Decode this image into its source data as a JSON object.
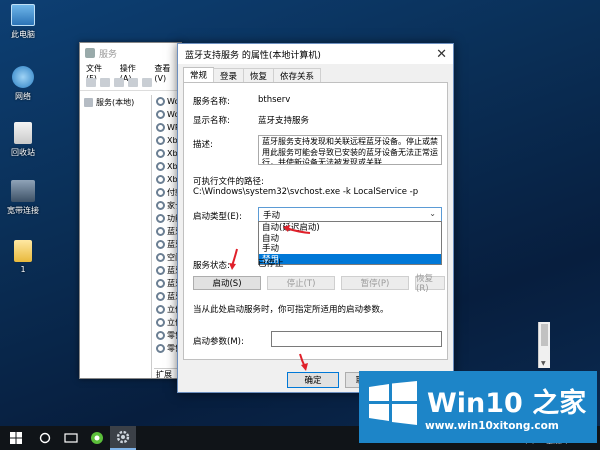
{
  "desktop": {
    "icons": [
      {
        "name": "pc-icon",
        "label": "此电脑"
      },
      {
        "name": "network-icon",
        "label": "网络"
      },
      {
        "name": "recycle-bin-icon",
        "label": "回收站"
      },
      {
        "name": "broadband-icon",
        "label": "宽带连接"
      },
      {
        "name": "folder-icon",
        "label": "1"
      }
    ]
  },
  "services_window": {
    "title": "服务",
    "menu": [
      "文件(F)",
      "操作(A)",
      "查看(V)"
    ],
    "tree_root": "服务(本地)",
    "services": [
      "Wo",
      "Wo",
      "WP",
      "Xb",
      "Xb",
      "Xb",
      "Xb",
      "付款",
      "家长",
      "功能",
      "蓝牙",
      "蓝牙",
      "空间",
      "蓝牙",
      "蓝牙",
      "蓝牙",
      "立体",
      "立体",
      "零售",
      "零售"
    ],
    "bottom_tab": "扩展"
  },
  "dialog": {
    "title": "蓝牙支持服务 的属性(本地计算机)",
    "close_glyph": "✕",
    "tabs": [
      "常规",
      "登录",
      "恢复",
      "依存关系"
    ],
    "service_name_label": "服务名称:",
    "service_name_value": "bthserv",
    "display_name_label": "显示名称:",
    "display_name_value": "蓝牙支持服务",
    "description_label": "描述:",
    "description_value": "蓝牙服务支持发现和关联远程蓝牙设备。停止或禁用此服务可能会导致已安装的蓝牙设备无法正常运行，并使新设备无法被发现或关联",
    "path_label": "可执行文件的路径:",
    "path_value": "C:\\Windows\\system32\\svchost.exe -k LocalService -p",
    "startup_label": "启动类型(E):",
    "startup_value": "手动",
    "startup_options": [
      {
        "label": "自动(延迟启动)",
        "selected": false
      },
      {
        "label": "自动",
        "selected": false
      },
      {
        "label": "手动",
        "selected": false
      },
      {
        "label": "禁用",
        "selected": true
      }
    ],
    "status_label": "服务状态:",
    "status_value": "已停止",
    "buttons": {
      "start": "启动(S)",
      "stop": "停止(T)",
      "pause": "暂停(P)",
      "resume": "恢复(R)"
    },
    "hint": "当从此处启动服务时，你可指定所适用的启动参数。",
    "param_label": "启动参数(M):",
    "param_value": "",
    "ok": "确定",
    "cancel": "取"
  },
  "watermark": {
    "title": "Win10 之家",
    "url": "www.win10xitong.com"
  },
  "taskbar_date_partial": "2020/5/30 星期六",
  "colors": {
    "accent": "#0078d7",
    "arrow": "#e0202a",
    "watermark": "#1d85c8"
  }
}
